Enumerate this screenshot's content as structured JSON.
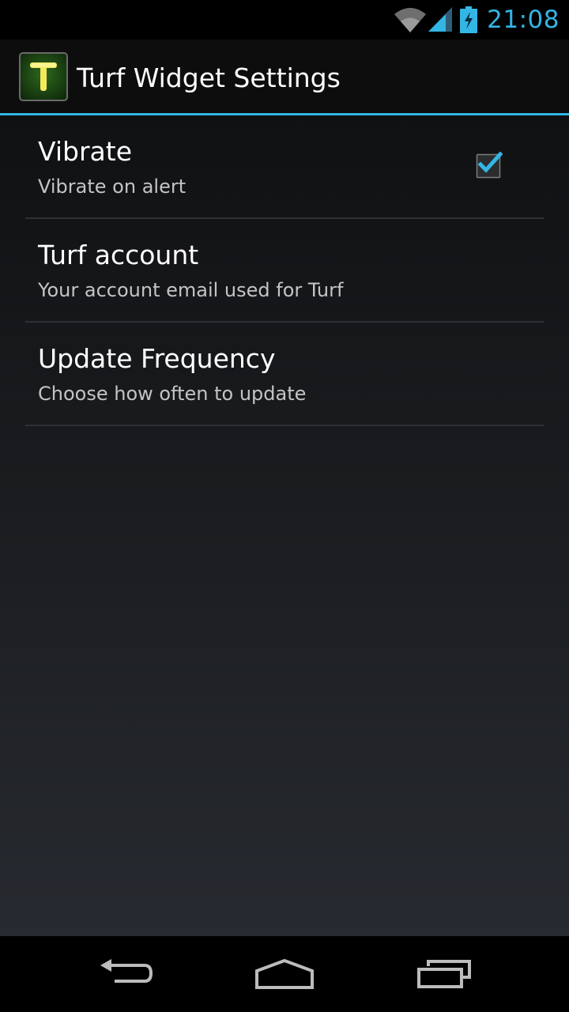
{
  "status_bar": {
    "time": "21:08",
    "icons": [
      "wifi-icon",
      "signal-icon",
      "battery-charging-icon"
    ]
  },
  "action_bar": {
    "title": "Turf Widget Settings",
    "icon": "app-icon",
    "icon_letter": "T"
  },
  "preferences": [
    {
      "title": "Vibrate",
      "summary": "Vibrate on alert",
      "checked": true
    },
    {
      "title": "Turf account",
      "summary": "Your account email used for Turf"
    },
    {
      "title": "Update Frequency",
      "summary": "Choose how often to update"
    }
  ],
  "navigation": {
    "buttons": [
      "back-icon",
      "home-icon",
      "recent-apps-icon"
    ]
  },
  "colors": {
    "accent": "#33b5e5",
    "icon_letter": "#e8e04a",
    "icon_background": "#1e4a14"
  }
}
